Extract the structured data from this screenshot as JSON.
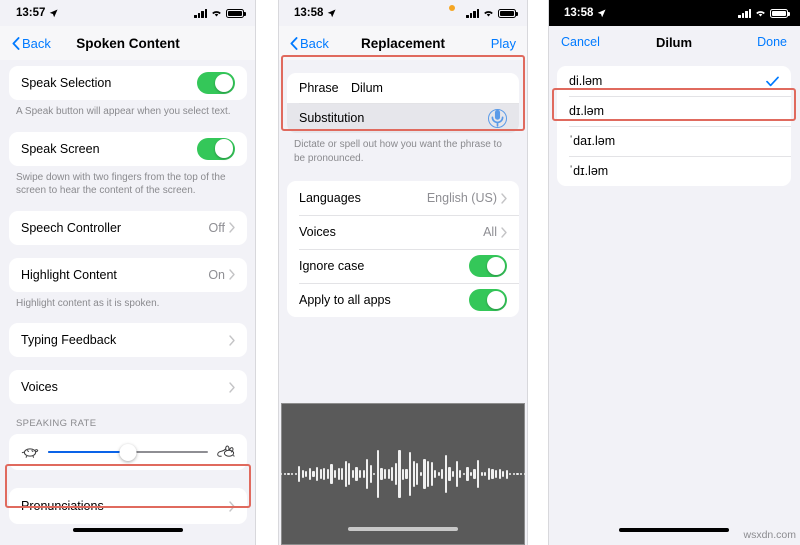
{
  "watermark": "wsxdn.com",
  "panel1": {
    "status": {
      "time": "13:57",
      "location_icon": "location-arrow-icon",
      "signal_icon": "cellular-bars-icon",
      "wifi_icon": "wifi-icon",
      "battery_icon": "battery-full-icon"
    },
    "nav": {
      "back": "Back",
      "title": "Spoken Content"
    },
    "rows": [
      {
        "label": "Speak Selection",
        "type": "toggle",
        "on": true,
        "footnote": "A Speak button will appear when you select text."
      },
      {
        "label": "Speak Screen",
        "type": "toggle",
        "on": true,
        "footnote": "Swipe down with two fingers from the top of the screen to hear the content of the screen."
      },
      {
        "label": "Speech Controller",
        "type": "disclosure",
        "value": "Off",
        "footnote": ""
      },
      {
        "label": "Highlight Content",
        "type": "disclosure",
        "value": "On",
        "footnote": "Highlight content as it is spoken."
      },
      {
        "label": "Typing Feedback",
        "type": "disclosure",
        "value": "",
        "footnote": ""
      },
      {
        "label": "Voices",
        "type": "disclosure",
        "value": "",
        "footnote": ""
      }
    ],
    "speaking_rate": {
      "header": "SPEAKING RATE",
      "slow_icon": "turtle-icon",
      "fast_icon": "rabbit-icon",
      "value_percent": 50
    },
    "pronunciations": {
      "label": "Pronunciations",
      "highlighted": true
    }
  },
  "panel2": {
    "status": {
      "time": "13:58",
      "recording_dot": "orange-recording-dot"
    },
    "nav": {
      "back": "Back",
      "title": "Replacement",
      "action": "Play"
    },
    "form": {
      "phrase_label": "Phrase",
      "phrase_value": "Dilum",
      "substitution_label": "Substitution",
      "substitution_value": "",
      "mic_icon": "microphone-icon",
      "footnote": "Dictate or spell out how you want the phrase to be pronounced."
    },
    "settings": [
      {
        "label": "Languages",
        "type": "disclosure",
        "value": "English (US)"
      },
      {
        "label": "Voices",
        "type": "disclosure",
        "value": "All"
      },
      {
        "label": "Ignore case",
        "type": "toggle",
        "on": true
      },
      {
        "label": "Apply to all apps",
        "type": "toggle",
        "on": true
      }
    ],
    "waveform": {
      "name": "audio-waveform",
      "bar_count": 95
    }
  },
  "panel3": {
    "status": {
      "time": "13:58"
    },
    "sheet_nav": {
      "cancel": "Cancel",
      "title": "Dilum",
      "done": "Done"
    },
    "options": [
      {
        "text": "di.ləm",
        "selected": true
      },
      {
        "text": "dɪ.ləm",
        "selected": false
      },
      {
        "text": "ˈdaɪ.ləm",
        "selected": false
      },
      {
        "text": "ˈdɪ.ləm",
        "selected": false
      }
    ],
    "check_icon": "checkmark-icon"
  },
  "colors": {
    "accent": "#007aff",
    "toggle_on": "#34c759",
    "highlight_box": "#e06a5e",
    "slider_fill": "#0a63e8"
  }
}
